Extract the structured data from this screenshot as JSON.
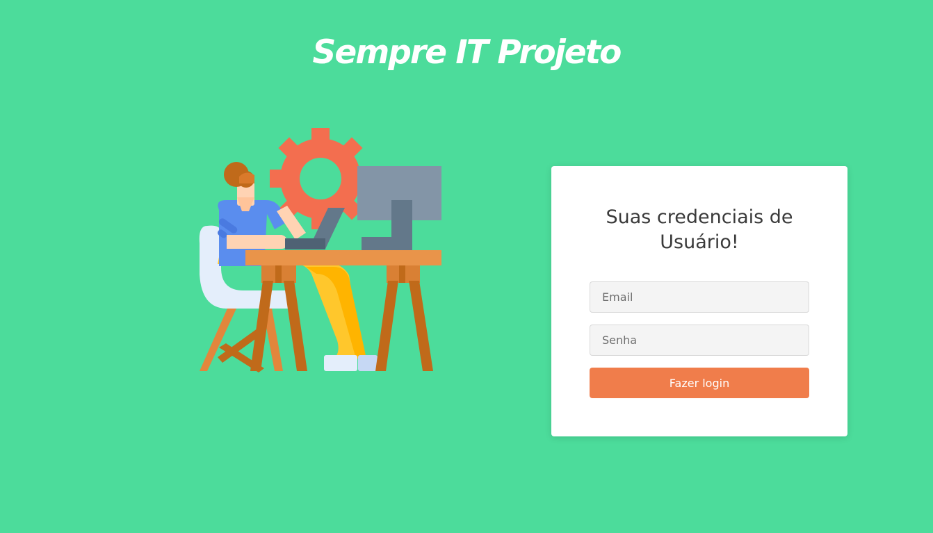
{
  "brand": {
    "title": "Sempre IT Projeto"
  },
  "login": {
    "heading": "Suas credenciais de Usuário!",
    "email_placeholder": "Email",
    "password_placeholder": "Senha",
    "submit_label": "Fazer login"
  },
  "colors": {
    "background": "#4cdc9b",
    "card": "#ffffff",
    "button": "#f07d4b",
    "field": "#f4f4f4"
  },
  "icons": {
    "illustration": "person-working-at-desk-illustration"
  }
}
